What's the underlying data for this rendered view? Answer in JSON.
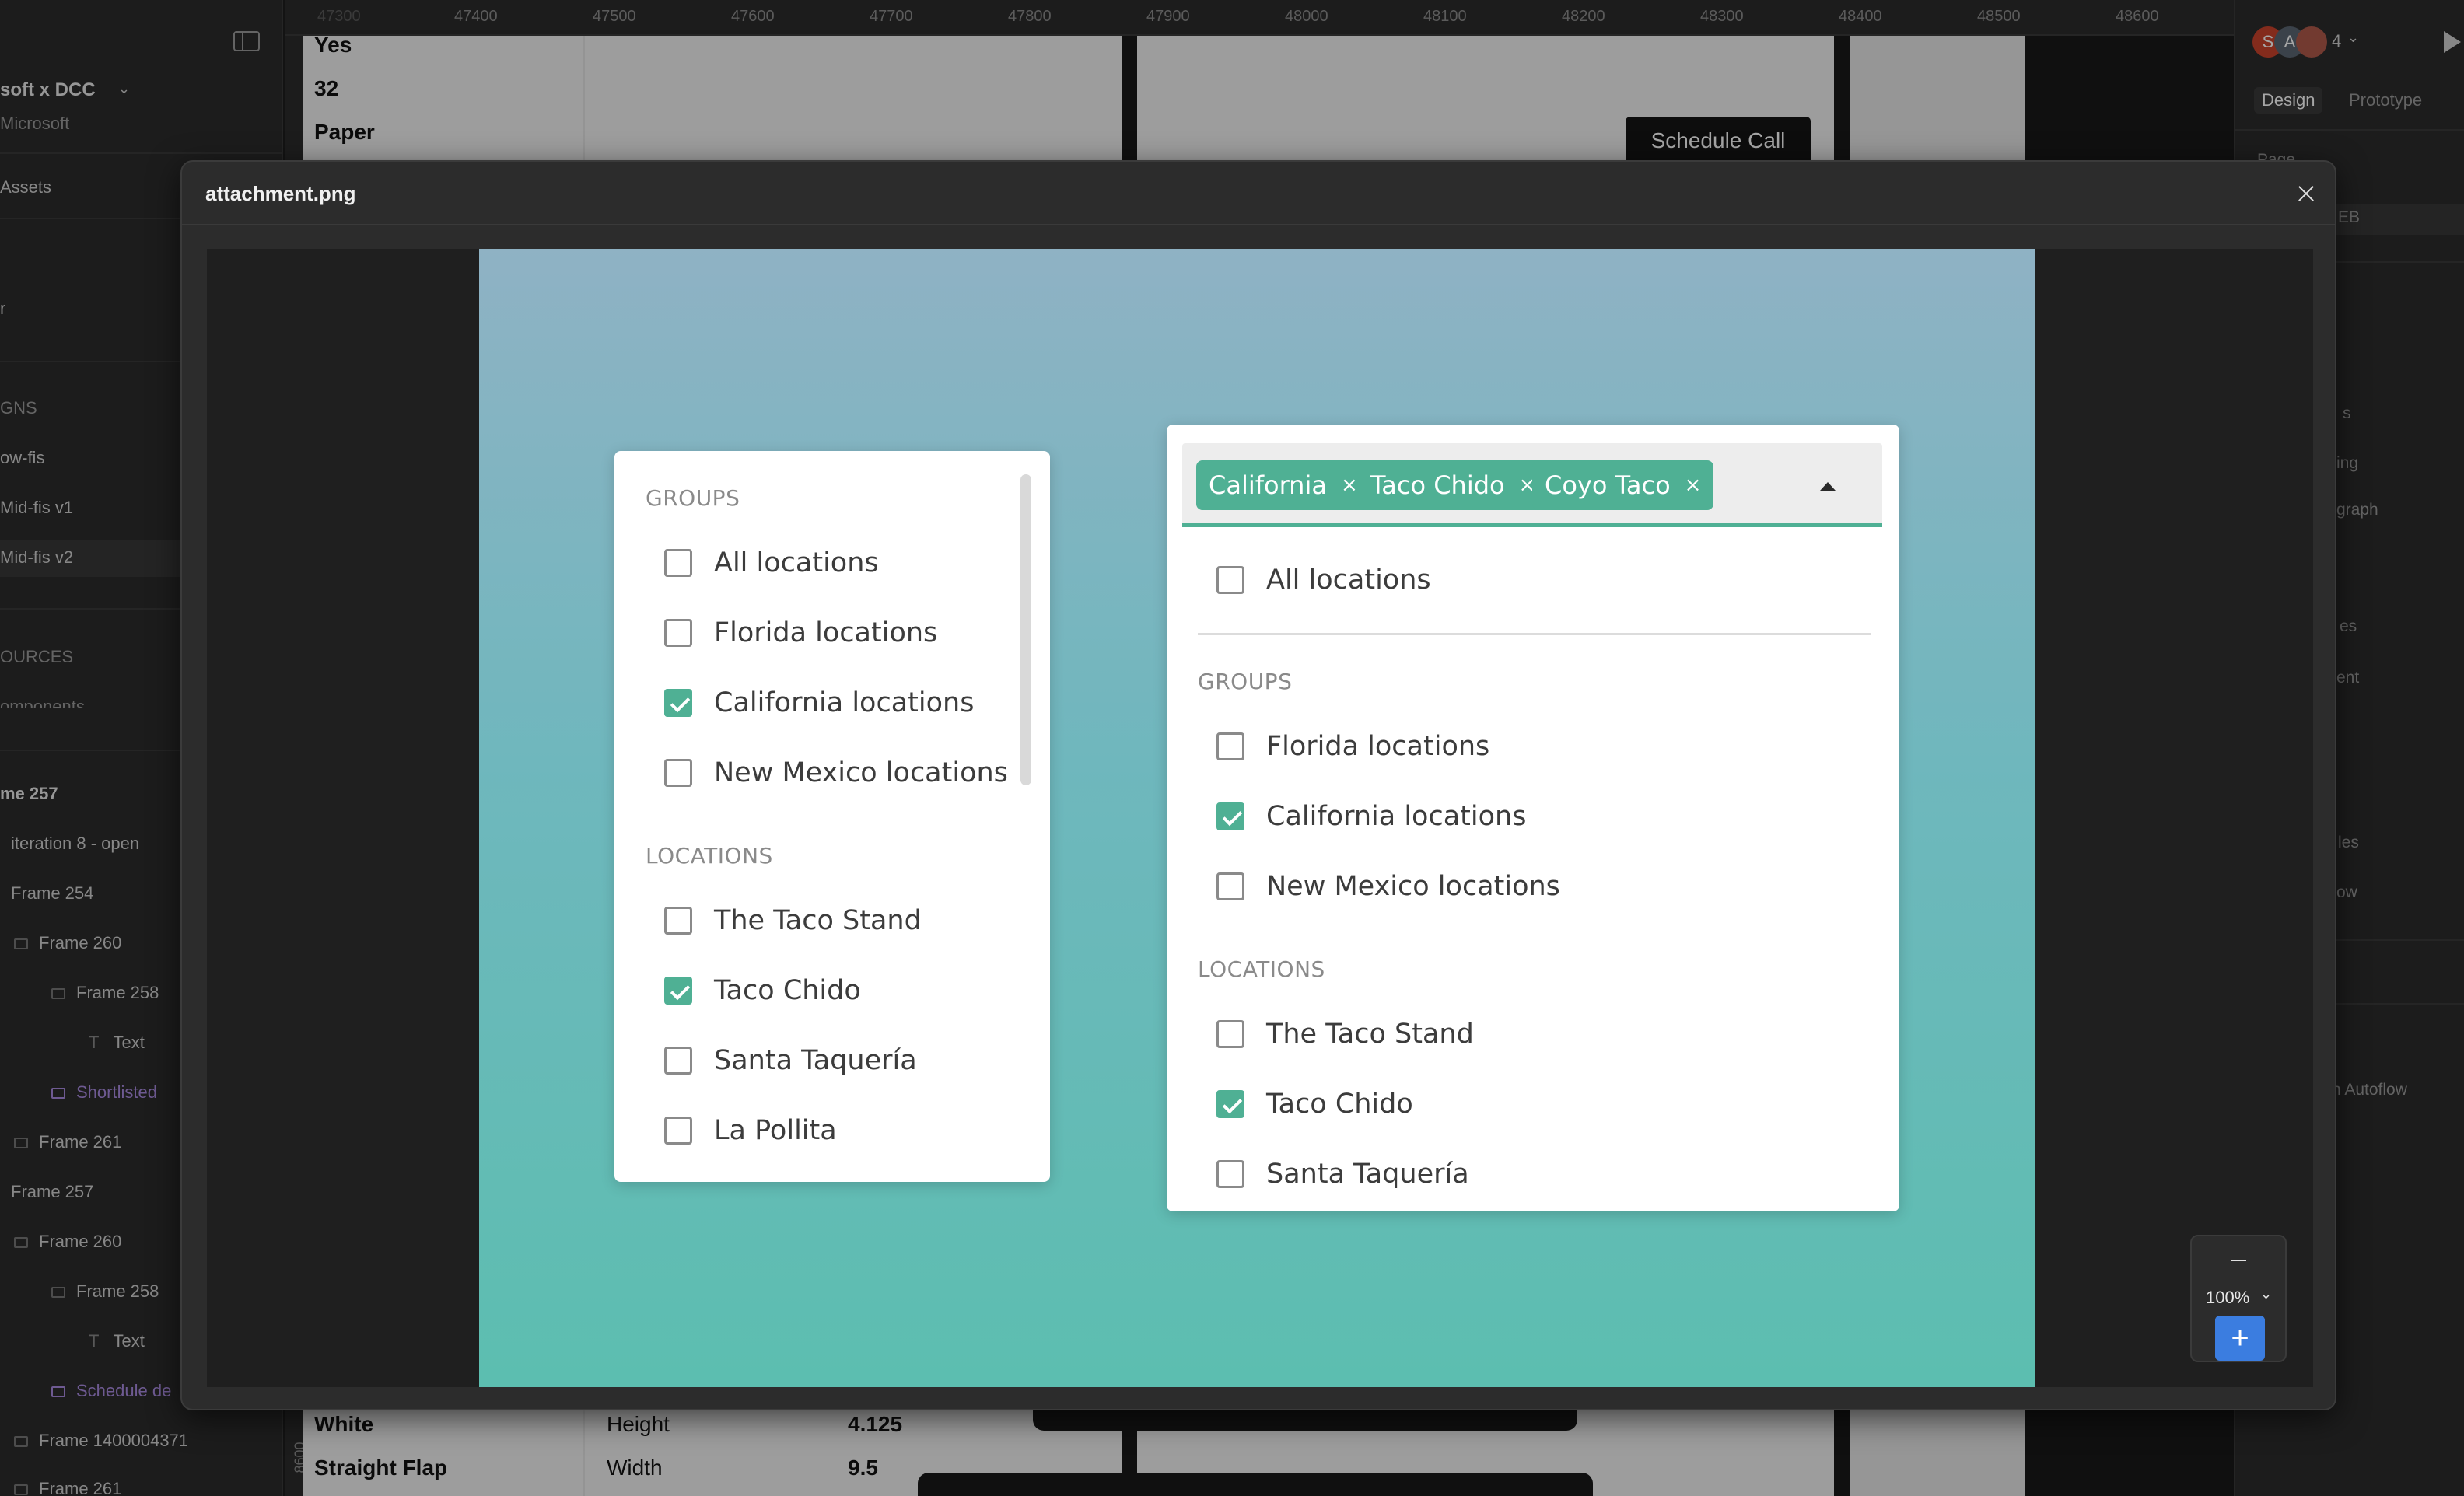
{
  "left_sidebar": {
    "file_name": "soft x DCC",
    "team": "Microsoft",
    "assets_label": "Assets",
    "partial_item": "r",
    "designs_heading": "GNS",
    "pages": [
      "ow-fis",
      "Mid-fis v1",
      "Mid-fis v2"
    ],
    "resources_heading": "OURCES",
    "resources_sub": "omponents",
    "layers": [
      {
        "label": "me 257",
        "style": "bold"
      },
      {
        "label": "iteration 8 - open",
        "style": "normal"
      },
      {
        "label": "Frame 254",
        "style": "normal"
      },
      {
        "label": "Frame 260",
        "style": "normal"
      },
      {
        "label": "Frame 258",
        "style": "normal"
      },
      {
        "label": "Text",
        "style": "normal"
      },
      {
        "label": "Shortlisted",
        "style": "component"
      },
      {
        "label": "Frame 261",
        "style": "normal"
      },
      {
        "label": "Frame 257",
        "style": "normal"
      },
      {
        "label": "Frame 260",
        "style": "normal"
      },
      {
        "label": "Frame 258",
        "style": "normal"
      },
      {
        "label": "Text",
        "style": "normal"
      },
      {
        "label": "Schedule de",
        "style": "component"
      },
      {
        "label": "Frame 1400004371",
        "style": "normal"
      },
      {
        "label": "Frame 261",
        "style": "normal"
      }
    ]
  },
  "ruler": {
    "ticks": [
      "47300",
      "47400",
      "47500",
      "47600",
      "47700",
      "47800",
      "47900",
      "48000",
      "48100",
      "48200",
      "48300",
      "48400",
      "48500",
      "48600"
    ],
    "vertical_tick": "8600"
  },
  "canvas": {
    "texts_top": [
      "Yes",
      "32",
      "Paper"
    ],
    "schedule_call_label": "Schedule Call",
    "table_rows": [
      {
        "a": "White",
        "b": "Height",
        "c": "4.125"
      },
      {
        "a": "Straight Flap",
        "b": "Width",
        "c": "9.5"
      }
    ]
  },
  "right_panel": {
    "collaborator_count": "4",
    "avatar_letters": [
      "S",
      "A"
    ],
    "tabs": [
      "Design",
      "Prototype"
    ],
    "fragments": [
      "Page",
      "EB",
      "s",
      "ing",
      "graph",
      "es",
      "ent",
      "les",
      "ow",
      "n Autoflow"
    ]
  },
  "modal": {
    "title": "attachment.png",
    "zoom_level": "100%",
    "zoom_in_symbol": "+"
  },
  "attachment": {
    "left_panel": {
      "groups_heading": "GROUPS",
      "groups": [
        {
          "label": "All locations",
          "checked": false
        },
        {
          "label": "Florida locations",
          "checked": false
        },
        {
          "label": "California locations",
          "checked": true
        },
        {
          "label": "New Mexico locations",
          "checked": false
        }
      ],
      "locations_heading": "LOCATIONS",
      "locations": [
        {
          "label": "The Taco Stand",
          "checked": false
        },
        {
          "label": "Taco Chido",
          "checked": true
        },
        {
          "label": "Santa Taquería",
          "checked": false
        },
        {
          "label": "La Pollita",
          "checked": false
        }
      ]
    },
    "right_panel": {
      "chips": [
        "California",
        "Taco Chido",
        "Coyo Taco"
      ],
      "chip_remove_symbol": "×",
      "all_option": {
        "label": "All locations",
        "checked": false
      },
      "groups_heading": "GROUPS",
      "groups": [
        {
          "label": "Florida locations",
          "checked": false
        },
        {
          "label": "California locations",
          "checked": true
        },
        {
          "label": "New Mexico locations",
          "checked": false
        }
      ],
      "locations_heading": "LOCATIONS",
      "locations": [
        {
          "label": "The Taco Stand",
          "checked": false
        },
        {
          "label": "Taco Chido",
          "checked": true
        },
        {
          "label": "Santa Taquería",
          "checked": false
        }
      ]
    },
    "colors": {
      "accent": "#4fb094",
      "gradient_top": "#8fb2c4",
      "gradient_bottom": "#5cbeb0"
    }
  }
}
